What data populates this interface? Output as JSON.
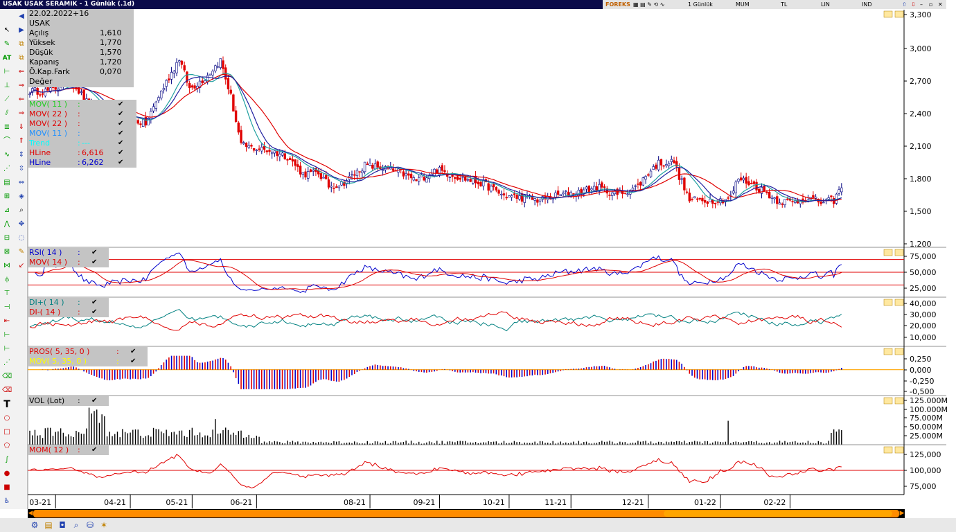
{
  "window": {
    "title": "USAK USAK SERAMIK - 1 Günlük (.1d)",
    "toolbar": {
      "brand": "FOREKS",
      "period": "1 Günlük",
      "chart_type": "MUM",
      "currency": "TL",
      "scale": "LIN",
      "mode": "IND"
    }
  },
  "info_box": {
    "date": "22.02.2022+16",
    "symbol": "USAK",
    "rows": [
      {
        "label": "Açılış",
        "value": "1,610"
      },
      {
        "label": "Yüksek",
        "value": "1,770"
      },
      {
        "label": "Düşük",
        "value": "1,570"
      },
      {
        "label": "Kapanış",
        "value": "1,720"
      },
      {
        "label": "Ö.Kap.Fark",
        "value": "0,070"
      },
      {
        "label": "Değer",
        "value": ""
      }
    ]
  },
  "legends": {
    "price": [
      {
        "name": "MOV( 11 )",
        "sep": ":",
        "val": "",
        "color": "#22cc22"
      },
      {
        "name": "MOV( 22 )",
        "sep": ":",
        "val": "",
        "color": "#e00000"
      },
      {
        "name": "MOV( 22 )",
        "sep": ":",
        "val": "",
        "color": "#e00000"
      },
      {
        "name": "MOV( 11 )",
        "sep": ":",
        "val": "",
        "color": "#1e90ff"
      },
      {
        "name": "Trend",
        "sep": ":",
        "val": "---",
        "color": "#00ffff"
      },
      {
        "name": "HLine",
        "sep": ":",
        "val": "6,616",
        "color": "#e00000"
      },
      {
        "name": "HLine",
        "sep": ":",
        "val": "6,262",
        "color": "#0000cc"
      }
    ],
    "rsi": [
      {
        "name": "RSI( 14 )",
        "sep": ":",
        "val": "",
        "color": "#0000cc"
      },
      {
        "name": "MOV( 14 )",
        "sep": ":",
        "val": "",
        "color": "#e00000"
      }
    ],
    "dmi": [
      {
        "name": "DI+( 14 )",
        "sep": ":",
        "val": "",
        "color": "#008080"
      },
      {
        "name": "DI-( 14 )",
        "sep": ":",
        "val": "",
        "color": "#e00000"
      }
    ],
    "pros": [
      {
        "name": "PROS( 5, 35, 0 )",
        "sep": ":",
        "val": "",
        "color": "#e00000"
      },
      {
        "name": "MOV( 5, 35, 0 )",
        "sep": ":",
        "val": "",
        "color": "#ffff00"
      }
    ],
    "vol": [
      {
        "name": "VOL (Lot)",
        "sep": ":",
        "val": "",
        "color": "#000000"
      }
    ],
    "mom": [
      {
        "name": "MOM( 12 )",
        "sep": ":",
        "val": "",
        "color": "#e00000"
      }
    ]
  },
  "chart_data": [
    {
      "type": "candlestick",
      "pane": "price",
      "y_ticks": [
        "3,300",
        "3,000",
        "2,700",
        "2,400",
        "2,100",
        "1,800",
        "1,500",
        "1,200"
      ],
      "ylim": [
        1.2,
        3.3
      ],
      "x_ticks": [
        "03-21",
        "04-21",
        "05-21",
        "06-21",
        "08-21",
        "09-21",
        "10-21",
        "11-21",
        "12-21",
        "01-22",
        "02-22"
      ],
      "close_anchors": [
        [
          0,
          2.6
        ],
        [
          8,
          2.6
        ],
        [
          16,
          2.7
        ],
        [
          22,
          2.5
        ],
        [
          28,
          2.38
        ],
        [
          38,
          2.35
        ],
        [
          45,
          2.3
        ],
        [
          50,
          2.55
        ],
        [
          58,
          2.9
        ],
        [
          62,
          2.62
        ],
        [
          68,
          2.72
        ],
        [
          74,
          2.88
        ],
        [
          78,
          2.55
        ],
        [
          82,
          2.1
        ],
        [
          86,
          2.08
        ],
        [
          94,
          2.05
        ],
        [
          100,
          2.0
        ],
        [
          106,
          1.84
        ],
        [
          112,
          1.85
        ],
        [
          116,
          1.73
        ],
        [
          121,
          1.75
        ],
        [
          124,
          1.8
        ],
        [
          130,
          1.92
        ],
        [
          136,
          1.9
        ],
        [
          144,
          1.85
        ],
        [
          150,
          1.78
        ],
        [
          158,
          1.88
        ],
        [
          164,
          1.83
        ],
        [
          168,
          1.8
        ],
        [
          176,
          1.75
        ],
        [
          184,
          1.64
        ],
        [
          192,
          1.62
        ],
        [
          198,
          1.6
        ],
        [
          206,
          1.65
        ],
        [
          214,
          1.68
        ],
        [
          220,
          1.72
        ],
        [
          228,
          1.65
        ],
        [
          236,
          1.73
        ],
        [
          240,
          1.85
        ],
        [
          244,
          1.94
        ],
        [
          250,
          1.95
        ],
        [
          252,
          1.82
        ],
        [
          256,
          1.6
        ],
        [
          262,
          1.6
        ],
        [
          268,
          1.6
        ],
        [
          272,
          1.63
        ],
        [
          275,
          1.8
        ],
        [
          280,
          1.75
        ],
        [
          285,
          1.68
        ],
        [
          290,
          1.6
        ],
        [
          296,
          1.58
        ],
        [
          302,
          1.62
        ],
        [
          307,
          1.58
        ],
        [
          312,
          1.6
        ],
        [
          315,
          1.72
        ]
      ],
      "series": [
        {
          "name": "MOV( 11 )",
          "period": 11,
          "color": "#20a0a0"
        },
        {
          "name": "MOV( 22 )",
          "period": 22,
          "color": "#e00000"
        },
        {
          "name": "MOV( 11 )",
          "period": 11,
          "color": "#2020a0"
        }
      ]
    },
    {
      "type": "line",
      "pane": "rsi",
      "y_ticks": [
        "75,000",
        "50,000",
        "25,000"
      ],
      "ylim": [
        15,
        85
      ],
      "hlines": [
        70,
        50,
        30
      ],
      "series": [
        {
          "name": "RSI( 14 )",
          "color": "#0000cc"
        },
        {
          "name": "MOV( 14 )",
          "color": "#e00000"
        }
      ]
    },
    {
      "type": "line",
      "pane": "dmi",
      "y_ticks": [
        "40,000",
        "30,000",
        "20,000",
        "10,000"
      ],
      "ylim": [
        5,
        42
      ],
      "series": [
        {
          "name": "DI+( 14 )",
          "color": "#008080"
        },
        {
          "name": "DI-( 14 )",
          "color": "#e00000"
        }
      ]
    },
    {
      "type": "bar",
      "pane": "pros",
      "y_ticks": [
        "0,250",
        "0,000",
        "-0,250",
        "-0,500"
      ],
      "ylim": [
        -0.55,
        0.35
      ],
      "series": [
        {
          "name": "PROS( 5, 35, 0 )",
          "color": "#e00000"
        },
        {
          "name": "MOV( 5, 35, 0 )",
          "color": "#ffa500"
        }
      ]
    },
    {
      "type": "bar",
      "pane": "vol",
      "y_ticks": [
        "125.000M",
        "100.000M",
        "75.000M",
        "50.000M",
        "25.000M"
      ],
      "ylim": [
        0,
        130
      ],
      "series": [
        {
          "name": "VOL (Lot)",
          "color": "#000000"
        }
      ]
    },
    {
      "type": "line",
      "pane": "mom",
      "y_ticks": [
        "125,000",
        "100,000",
        "75,000"
      ],
      "ylim": [
        65,
        135
      ],
      "hlines": [
        100
      ],
      "series": [
        {
          "name": "MOM( 12 )",
          "color": "#e00000"
        }
      ]
    }
  ]
}
